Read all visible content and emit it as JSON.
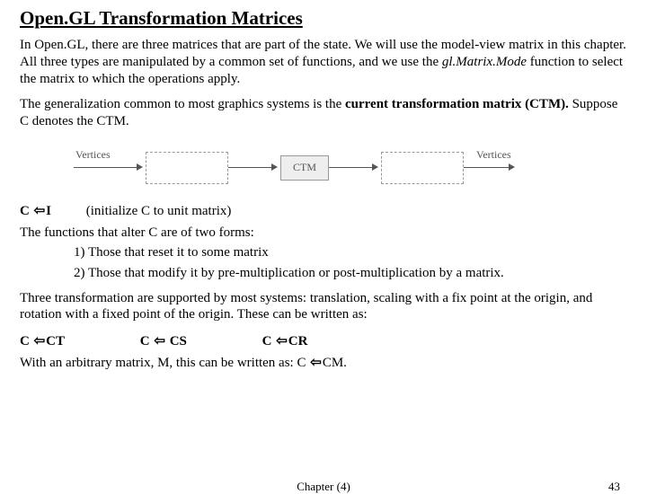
{
  "title": "Open.GL Transformation Matrices",
  "p1a": "In Open.GL, there are three matrices that are part of the state.  We will use the model-view matrix in this chapter.  All three types are manipulated by a common set of functions, and we use the ",
  "p1b": "gl.Matrix.Mode",
  "p1c": " function to select the matrix to which the operations apply.",
  "p2a": "The generalization common to most graphics systems is the ",
  "p2b": "current transformation matrix (CTM).",
  "p2c": "  Suppose C denotes the CTM.",
  "diagram": {
    "vertices_in": "Vertices",
    "ctm": "CTM",
    "vertices_out": "Vertices"
  },
  "eq1_lhs": "C ",
  "eq1_rhs": "I",
  "eq1_note": "(initialize C to unit matrix)",
  "p3": "The functions that alter C are of two forms:",
  "item1": "1) Those that reset it to some matrix",
  "item2": "2) Those that modify it by pre-multiplication or post-multiplication by a matrix.",
  "p4": "Three transformation are supported by most systems: translation, scaling with a fix point at the origin, and rotation with a fixed point of the origin. These can be written as:",
  "eqA_l": "C ",
  "eqA_r": "CT",
  "eqB_l": "C ",
  "eqB_r": " CS",
  "eqC_l": "C ",
  "eqC_r": "CR",
  "p5a": "With an arbitrary matrix, M, this can be written as: C ",
  "p5b": "CM.",
  "footer_center": "Chapter (4)",
  "footer_right": "43",
  "arrow_glyph": "⇦"
}
